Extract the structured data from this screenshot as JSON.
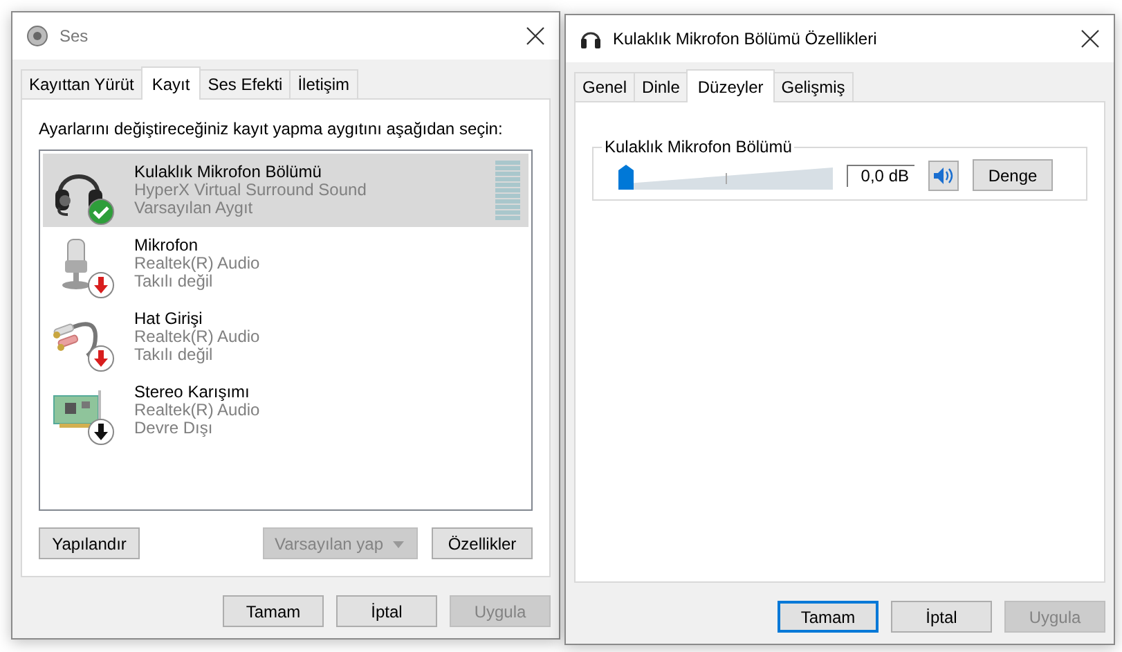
{
  "sound_window": {
    "title": "Ses",
    "tabs": [
      {
        "label": "Kayıttan Yürüt",
        "selected": false
      },
      {
        "label": "Kayıt",
        "selected": true
      },
      {
        "label": "Ses Efekti",
        "selected": false
      },
      {
        "label": "İletişim",
        "selected": false
      }
    ],
    "instruction": "Ayarlarını değiştireceğiniz kayıt yapma aygıtını aşağıdan seçin:",
    "devices": [
      {
        "kind": "headset",
        "name": "Kulaklık Mikrofon Bölümü",
        "driver": "HyperX Virtual Surround Sound",
        "status": "Varsayılan Aygıt",
        "badge": {
          "kind": "check"
        },
        "selected": true
      },
      {
        "kind": "microphone",
        "name": "Mikrofon",
        "driver": "Realtek(R) Audio",
        "status": "Takılı değil",
        "badge": {
          "kind": "red_arrow"
        },
        "selected": false
      },
      {
        "kind": "line_in",
        "name": "Hat Girişi",
        "driver": "Realtek(R) Audio",
        "status": "Takılı değil",
        "badge": {
          "kind": "red_arrow"
        },
        "selected": false
      },
      {
        "kind": "sound_card",
        "name": "Stereo Karışımı",
        "driver": "Realtek(R) Audio",
        "status": "Devre Dışı",
        "badge": {
          "kind": "black_arrow"
        },
        "selected": false
      }
    ],
    "configure_button": {
      "label": "Yapılandır",
      "disabled": false
    },
    "set_default_button": {
      "label": "Varsayılan yap",
      "disabled": true
    },
    "properties_button": {
      "label": "Özellikler",
      "disabled": false
    },
    "buttons": [
      {
        "label": "Tamam",
        "disabled": false,
        "default": false
      },
      {
        "label": "İptal",
        "disabled": false,
        "default": false
      },
      {
        "label": "Uygula",
        "disabled": true,
        "default": false
      }
    ]
  },
  "properties_window": {
    "title": "Kulaklık Mikrofon Bölümü Özellikleri",
    "tabs": [
      {
        "label": "Genel",
        "selected": false
      },
      {
        "label": "Dinle",
        "selected": false
      },
      {
        "label": "Düzeyler",
        "selected": true
      },
      {
        "label": "Gelişmiş",
        "selected": false
      }
    ],
    "levels": {
      "label": "Kulaklık Mikrofon Bölümü",
      "level": 0,
      "reading": "0,0 dB",
      "muted": false,
      "balance_button": "Denge"
    },
    "buttons": [
      {
        "label": "Tamam",
        "disabled": false,
        "default": true
      },
      {
        "label": "İptal",
        "disabled": false,
        "default": false
      },
      {
        "label": "Uygula",
        "disabled": true,
        "default": false
      }
    ]
  }
}
